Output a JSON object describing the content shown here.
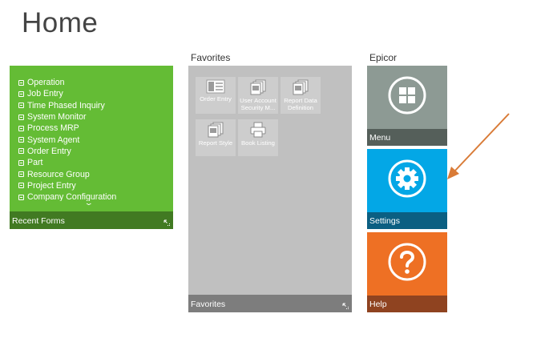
{
  "page": {
    "title": "Home"
  },
  "sections": {
    "favorites_label": "Favorites",
    "epicor_label": "Epicor"
  },
  "recent_forms": {
    "items": [
      "Operation",
      "Job Entry",
      "Time Phased Inquiry",
      "System Monitor",
      "Process MRP",
      "System Agent",
      "Order Entry",
      "Part",
      "Resource Group",
      "Project Entry",
      "Company Configuration"
    ],
    "footer_label": "Recent Forms",
    "icon": "form-icon"
  },
  "favorites": {
    "items": [
      {
        "label": "Order Entry",
        "icon": "form-icon"
      },
      {
        "label": "User Account Security M...",
        "icon": "report-stack-icon"
      },
      {
        "label": "Report Data Definition",
        "icon": "report-stack-icon"
      },
      {
        "label": "Report Style",
        "icon": "report-stack-icon"
      },
      {
        "label": "Book Listing",
        "icon": "printer-icon"
      }
    ],
    "footer_label": "Favorites"
  },
  "epicor": {
    "menu": {
      "label": "Menu",
      "icon": "grid-icon"
    },
    "settings": {
      "label": "Settings",
      "icon": "gear-icon"
    },
    "help": {
      "label": "Help",
      "icon": "question-icon"
    }
  },
  "colors": {
    "recent_tile": "#64bc35",
    "favorites_tile": "#c0c0c0",
    "menu_tile": "#8d9a94",
    "settings_tile": "#03a7e6",
    "help_tile": "#ee7024",
    "annotation_arrow": "#d97b37"
  }
}
